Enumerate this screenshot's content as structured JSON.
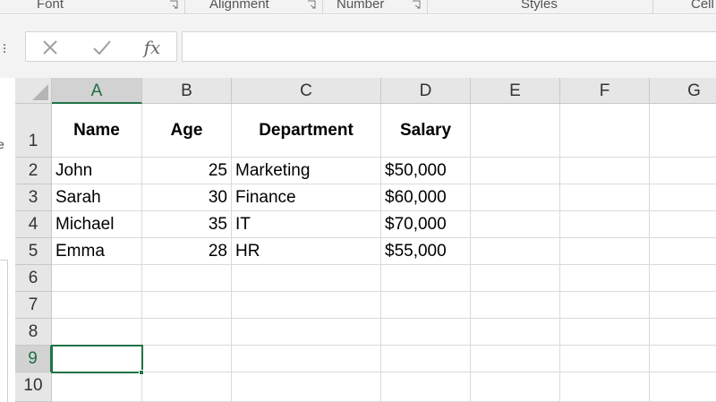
{
  "ribbon": {
    "groups": [
      {
        "label": "Font"
      },
      {
        "label": "Alignment"
      },
      {
        "label": "Number"
      },
      {
        "label": "Styles"
      },
      {
        "label": "Cell"
      }
    ]
  },
  "formula_bar": {
    "cancel_icon": "close-icon",
    "enter_icon": "checkmark-icon",
    "function_label": "fx",
    "value": ""
  },
  "side": {
    "truncated_letter": "e"
  },
  "sheet": {
    "columns": [
      "A",
      "B",
      "C",
      "D",
      "E",
      "F",
      "G"
    ],
    "rows": [
      "1",
      "2",
      "3",
      "4",
      "5",
      "6",
      "7",
      "8",
      "9",
      "10"
    ],
    "selected_column": "A",
    "selected_row": "9",
    "active_cell": "A9",
    "header": {
      "name": "Name",
      "age": "Age",
      "department": "Department",
      "salary": "Salary"
    },
    "records": [
      {
        "name": "John",
        "age": "25",
        "department": "Marketing",
        "salary": "$50,000"
      },
      {
        "name": "Sarah",
        "age": "30",
        "department": "Finance",
        "salary": "$60,000"
      },
      {
        "name": "Michael",
        "age": "35",
        "department": "IT",
        "salary": "$70,000"
      },
      {
        "name": "Emma",
        "age": "28",
        "department": "HR",
        "salary": "$55,000"
      }
    ]
  },
  "colors": {
    "accent": "#217346",
    "header_bg": "#e6e6e6",
    "gridline": "#dadada"
  }
}
